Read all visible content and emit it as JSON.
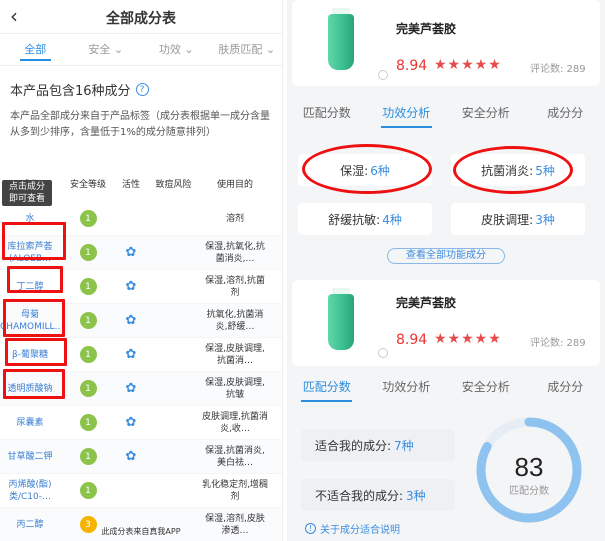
{
  "left": {
    "back": "‹",
    "title": "全部成分表",
    "tabs": [
      {
        "label": "全部"
      },
      {
        "label": "安全 ⌄"
      },
      {
        "label": "功效 ⌄"
      },
      {
        "label": "肤质匹配 ⌄"
      }
    ],
    "count_text": "本产品包含16种成分",
    "help_icon": "?",
    "description": "本产品全部成分来自于产品标签（成分表根据单一成分含量从多到少排序，含量低于1%的成分随意排列）",
    "headers": [
      "成分",
      "安全等级",
      "活性",
      "致痘风险",
      "使用目的"
    ],
    "tooltip": "点击成分\n即可查看",
    "rows": [
      {
        "name": "水",
        "safe": "1",
        "active": "",
        "use": "溶剂"
      },
      {
        "name": "库拉索芦荟(ALOEB…",
        "safe": "1",
        "active": "✿",
        "use": "保湿,抗氧化,抗菌消炎,…"
      },
      {
        "name": "丁二醇",
        "safe": "1",
        "active": "✿",
        "use": "保湿,溶剂,抗菌剂"
      },
      {
        "name": "母菊(CHAMOMILL…",
        "safe": "1",
        "active": "✿",
        "use": "抗氧化,抗菌消炎,舒缓…"
      },
      {
        "name": "β-葡聚糖",
        "safe": "1",
        "active": "✿",
        "use": "保湿,皮肤调理,抗菌消…"
      },
      {
        "name": "透明质酸钠",
        "safe": "1",
        "active": "✿",
        "use": "保湿,皮肤调理,抗皱"
      },
      {
        "name": "尿囊素",
        "safe": "1",
        "active": "✿",
        "use": "皮肤调理,抗菌消炎,收…"
      },
      {
        "name": "甘草酸二钾",
        "safe": "1",
        "active": "✿",
        "use": "保湿,抗菌消炎,美白祛…"
      },
      {
        "name": "丙烯酸(酯)类/C10-…",
        "safe": "1",
        "active": "",
        "use": "乳化稳定剂,增稠剂"
      },
      {
        "name": "丙二醇",
        "safe": "3",
        "active": "",
        "use": "保湿,溶剂,皮肤渗透…"
      }
    ],
    "footer": "此成分表来自真我APP"
  },
  "right": {
    "product_name": "完美芦荟胶",
    "score": "8.94",
    "stars": "★★★★★",
    "reviews": "评论数: 289",
    "tabs": [
      "匹配分数",
      "功效分析",
      "安全分析",
      "成分分"
    ],
    "efficacy": [
      {
        "label": "保湿:",
        "value": "6种"
      },
      {
        "label": "抗菌消炎:",
        "value": "5种"
      },
      {
        "label": "舒缓抗敏:",
        "value": "4种"
      },
      {
        "label": "皮肤调理:",
        "value": "3种"
      }
    ],
    "view_all": "查看全部功能成分",
    "fit_label": "适合我的成分:",
    "fit_value": "7种",
    "unfit_label": "不适合我的成分:",
    "unfit_value": "3种",
    "match_score": "83",
    "match_label": "匹配分数",
    "match_fraction": 0.83,
    "note": "关于成分适合说明",
    "note_icon": "!"
  },
  "colors": {
    "accent": "#2a8ee0",
    "highlight": "#e11111",
    "safe_green": "#8cc34b",
    "star_red": "#e74c4c"
  }
}
